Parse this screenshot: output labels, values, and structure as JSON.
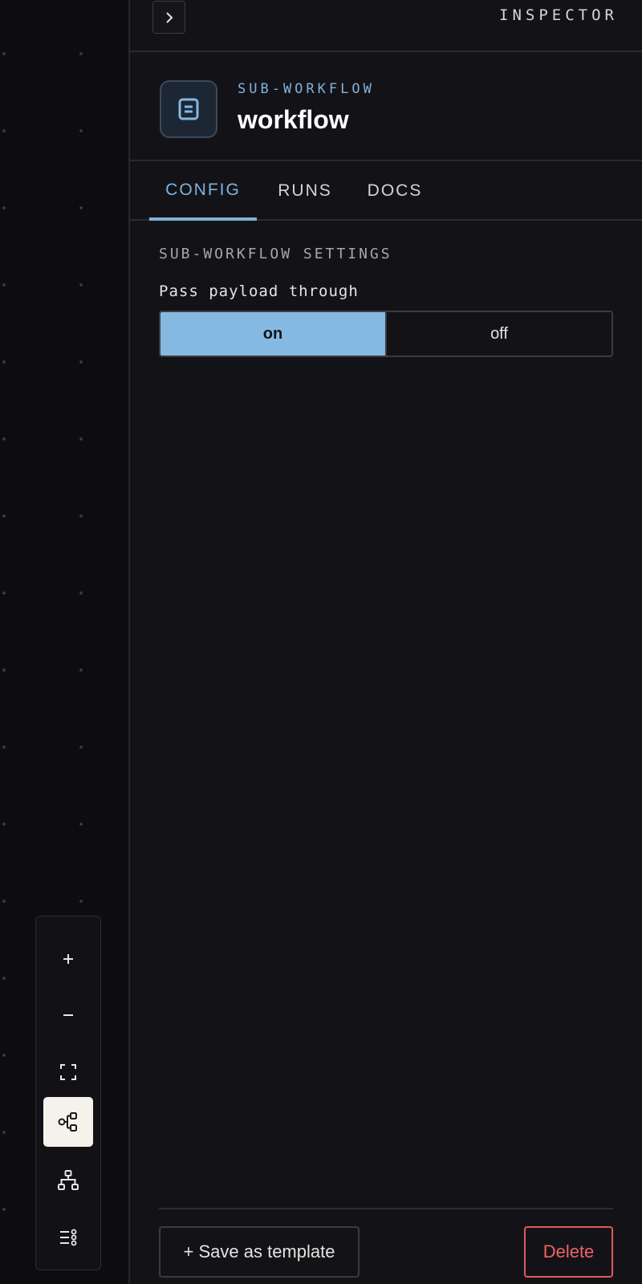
{
  "canvas": {
    "controls": [
      {
        "name": "zoom-in-button",
        "icon": "plus-icon",
        "active": false
      },
      {
        "name": "zoom-out-button",
        "icon": "minus-icon",
        "active": false
      },
      {
        "name": "fit-view-button",
        "icon": "fit-view-icon",
        "active": false
      },
      {
        "name": "flow-layout-button",
        "icon": "flow-layout-icon",
        "active": true
      },
      {
        "name": "tree-layout-button",
        "icon": "tree-layout-icon",
        "active": false
      },
      {
        "name": "list-layout-button",
        "icon": "list-layout-icon",
        "active": false
      }
    ]
  },
  "inspector": {
    "title": "INSPECTOR",
    "collapse_icon": "chevron-right-icon",
    "node": {
      "kind": "SUB-WORKFLOW",
      "name": "workflow",
      "icon": "document-icon"
    },
    "tabs": [
      {
        "label": "CONFIG",
        "active": true
      },
      {
        "label": "RUNS",
        "active": false
      },
      {
        "label": "DOCS",
        "active": false
      }
    ],
    "section_title": "SUB-WORKFLOW SETTINGS",
    "field": {
      "label": "Pass payload through",
      "options": [
        "on",
        "off"
      ],
      "selected": "on"
    },
    "footer": {
      "template_label": "+ Save as template",
      "delete_label": "Delete"
    }
  },
  "colors": {
    "accent": "#7fb2de",
    "selected_segment": "#86b9e2",
    "danger": "#e05a5a",
    "panel_bg": "#131317",
    "canvas_bg": "#0d0d0f"
  }
}
